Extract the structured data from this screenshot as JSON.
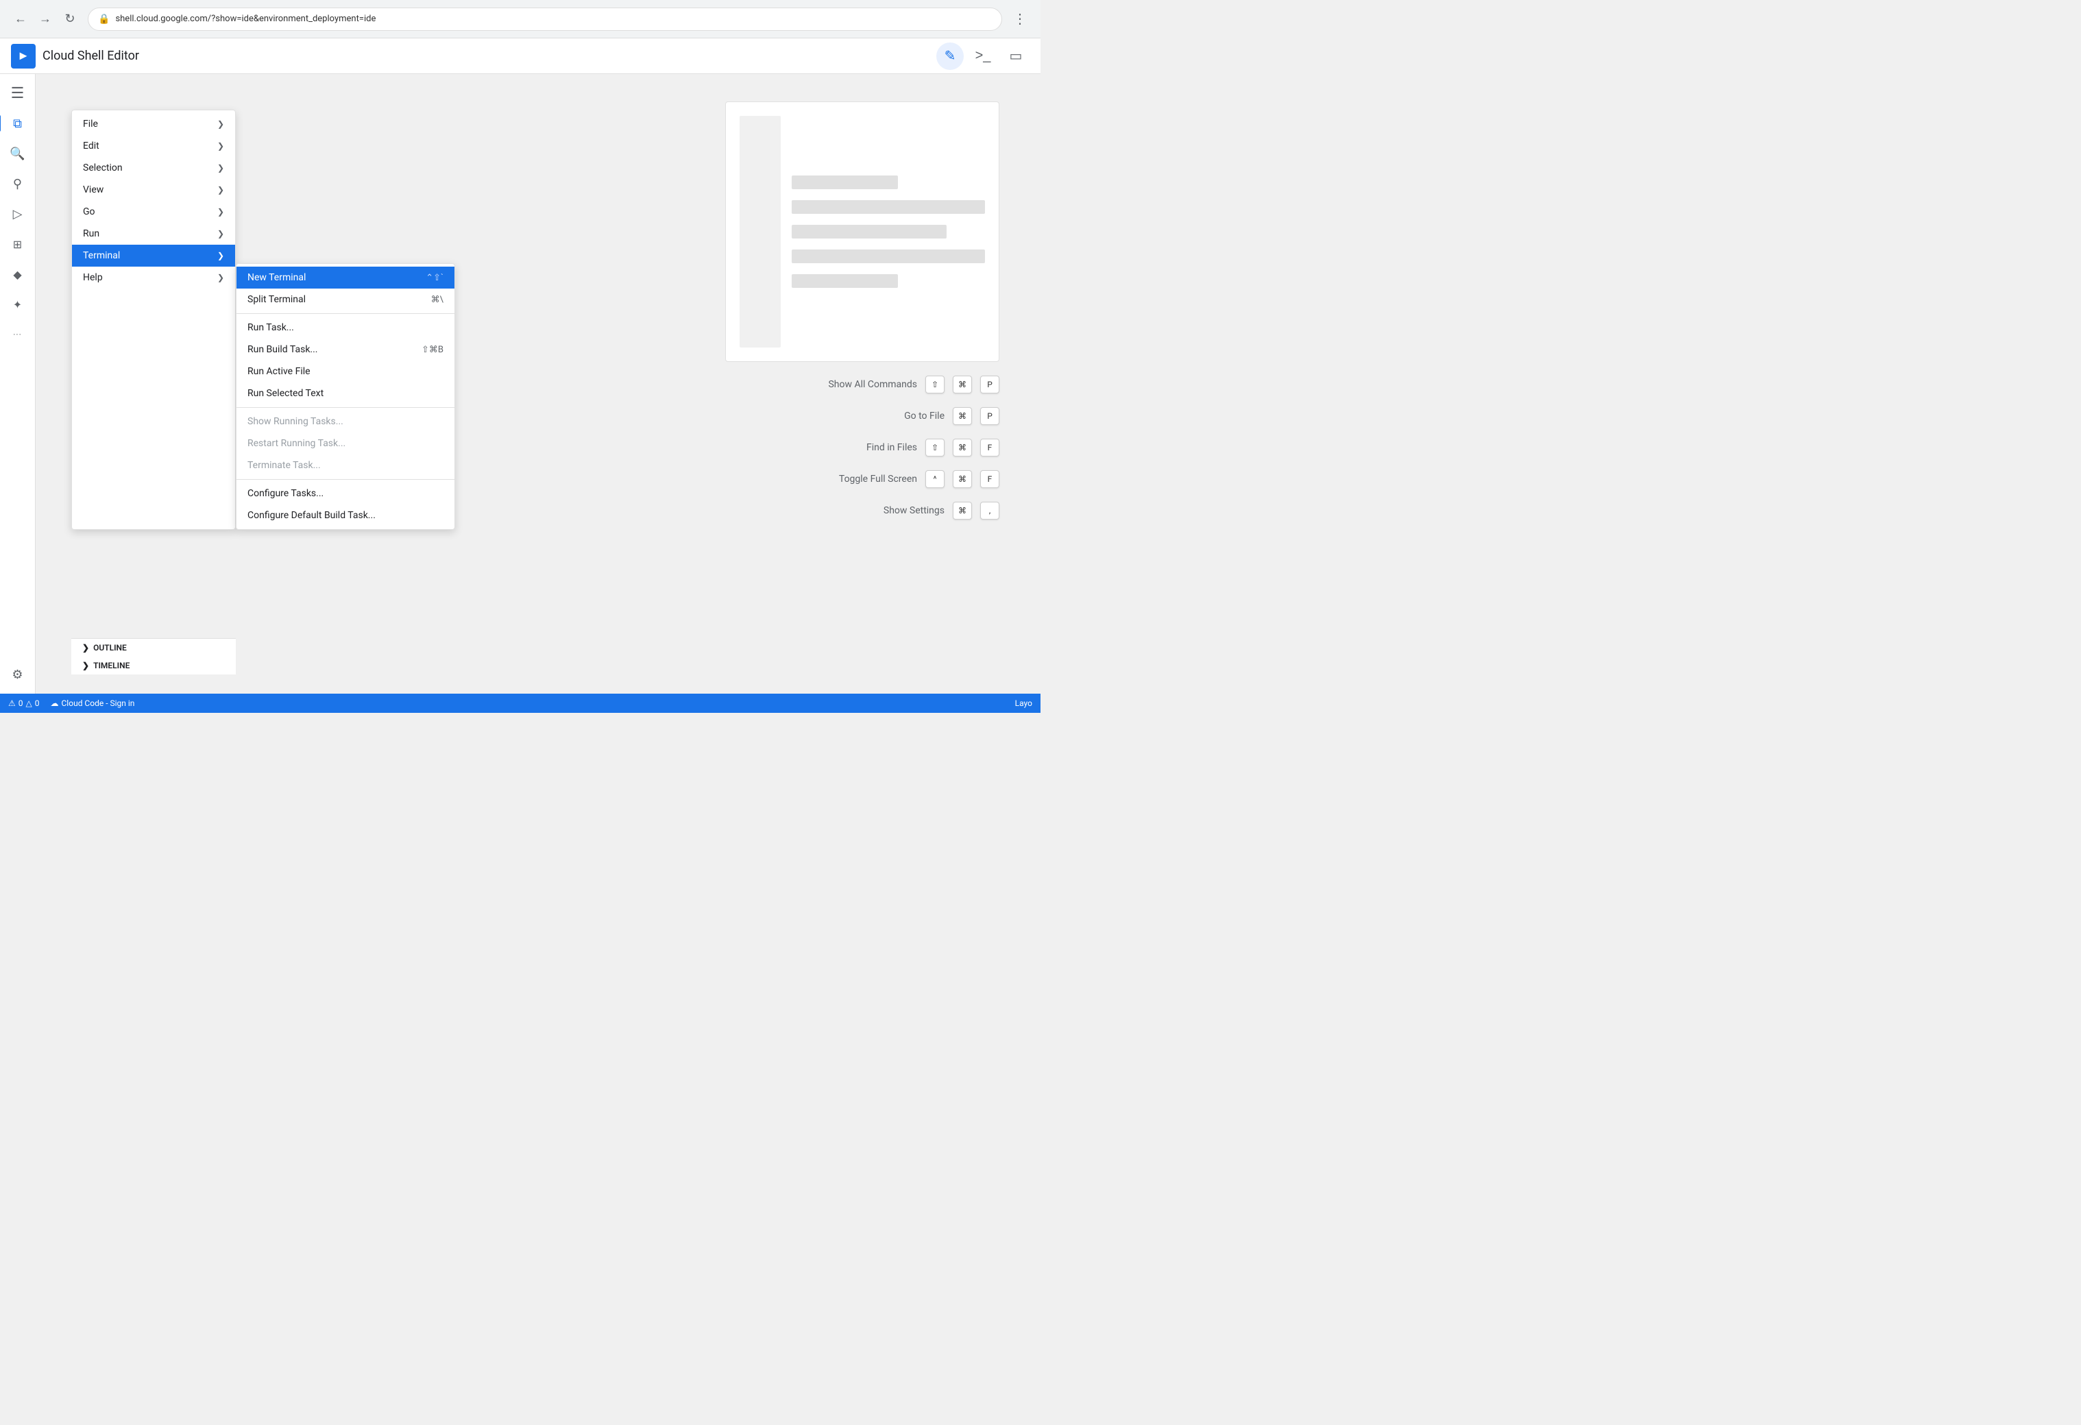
{
  "browser": {
    "url": "shell.cloud.google.com/?show=ide&environment_deployment=ide",
    "back_disabled": false,
    "forward_disabled": false
  },
  "header": {
    "title": "Cloud Shell Editor",
    "logo_symbol": "▶",
    "actions": [
      {
        "id": "edit-icon",
        "symbol": "✏",
        "active": true
      },
      {
        "id": "terminal-icon",
        "symbol": ">_",
        "active": false
      },
      {
        "id": "screen-icon",
        "symbol": "⬚",
        "active": false
      }
    ]
  },
  "sidebar": {
    "items": [
      {
        "id": "menu-icon",
        "symbol": "≡",
        "active": false
      },
      {
        "id": "files-icon",
        "symbol": "⧉",
        "active": true
      },
      {
        "id": "search-icon",
        "symbol": "🔍",
        "active": false
      },
      {
        "id": "git-icon",
        "symbol": "⑂",
        "active": false
      },
      {
        "id": "run-icon",
        "symbol": "▷",
        "active": false
      },
      {
        "id": "extensions-icon",
        "symbol": "⊞",
        "active": false
      },
      {
        "id": "diamond-icon",
        "symbol": "◆",
        "active": false
      },
      {
        "id": "star-icon",
        "symbol": "✦",
        "active": false
      },
      {
        "id": "more-icon",
        "symbol": "···",
        "active": false
      }
    ],
    "bottom": [
      {
        "id": "settings-icon",
        "symbol": "⚙",
        "active": false
      }
    ]
  },
  "primary_menu": {
    "items": [
      {
        "id": "file",
        "label": "File",
        "has_submenu": true
      },
      {
        "id": "edit",
        "label": "Edit",
        "has_submenu": true
      },
      {
        "id": "selection",
        "label": "Selection",
        "has_submenu": true
      },
      {
        "id": "view",
        "label": "View",
        "has_submenu": true
      },
      {
        "id": "go",
        "label": "Go",
        "has_submenu": true
      },
      {
        "id": "run",
        "label": "Run",
        "has_submenu": true
      },
      {
        "id": "terminal",
        "label": "Terminal",
        "has_submenu": true,
        "active": true
      },
      {
        "id": "help",
        "label": "Help",
        "has_submenu": true
      }
    ]
  },
  "secondary_menu": {
    "items": [
      {
        "id": "new-terminal",
        "label": "New Terminal",
        "shortcut": "⌃⇧`",
        "active": true,
        "disabled": false,
        "separator_after": false
      },
      {
        "id": "split-terminal",
        "label": "Split Terminal",
        "shortcut": "⌘\\",
        "active": false,
        "disabled": false,
        "separator_after": true
      },
      {
        "id": "run-task",
        "label": "Run Task...",
        "shortcut": "",
        "active": false,
        "disabled": false,
        "separator_after": false
      },
      {
        "id": "run-build-task",
        "label": "Run Build Task...",
        "shortcut": "⇧⌘B",
        "active": false,
        "disabled": false,
        "separator_after": false
      },
      {
        "id": "run-active-file",
        "label": "Run Active File",
        "shortcut": "",
        "active": false,
        "disabled": false,
        "separator_after": false
      },
      {
        "id": "run-selected-text",
        "label": "Run Selected Text",
        "shortcut": "",
        "active": false,
        "disabled": false,
        "separator_after": true
      },
      {
        "id": "show-running-tasks",
        "label": "Show Running Tasks...",
        "shortcut": "",
        "active": false,
        "disabled": true,
        "separator_after": false
      },
      {
        "id": "restart-running-task",
        "label": "Restart Running Task...",
        "shortcut": "",
        "active": false,
        "disabled": true,
        "separator_after": false
      },
      {
        "id": "terminate-task",
        "label": "Terminate Task...",
        "shortcut": "",
        "active": false,
        "disabled": true,
        "separator_after": true
      },
      {
        "id": "configure-tasks",
        "label": "Configure Tasks...",
        "shortcut": "",
        "active": false,
        "disabled": false,
        "separator_after": false
      },
      {
        "id": "configure-default-build",
        "label": "Configure Default Build Task...",
        "shortcut": "",
        "active": false,
        "disabled": false,
        "separator_after": false
      }
    ]
  },
  "shortcuts": [
    {
      "id": "show-all-commands",
      "label": "Show All Commands",
      "keys": [
        "⇧",
        "⌘",
        "P"
      ]
    },
    {
      "id": "go-to-file",
      "label": "Go to File",
      "keys": [
        "⌘",
        "P"
      ]
    },
    {
      "id": "find-in-files",
      "label": "Find in Files",
      "keys": [
        "⇧",
        "⌘",
        "F"
      ]
    },
    {
      "id": "toggle-fullscreen",
      "label": "Toggle Full Screen",
      "keys": [
        "^",
        "⌘",
        "F"
      ]
    },
    {
      "id": "show-settings",
      "label": "Show Settings",
      "keys": [
        "⌘",
        ","
      ]
    }
  ],
  "status_bar": {
    "error_count": "0",
    "warning_count": "0",
    "cloud_code_label": "Cloud Code - Sign in",
    "layout_label": "Layo"
  },
  "outline": {
    "items": [
      {
        "label": "OUTLINE"
      },
      {
        "label": "TIMELINE"
      }
    ]
  }
}
